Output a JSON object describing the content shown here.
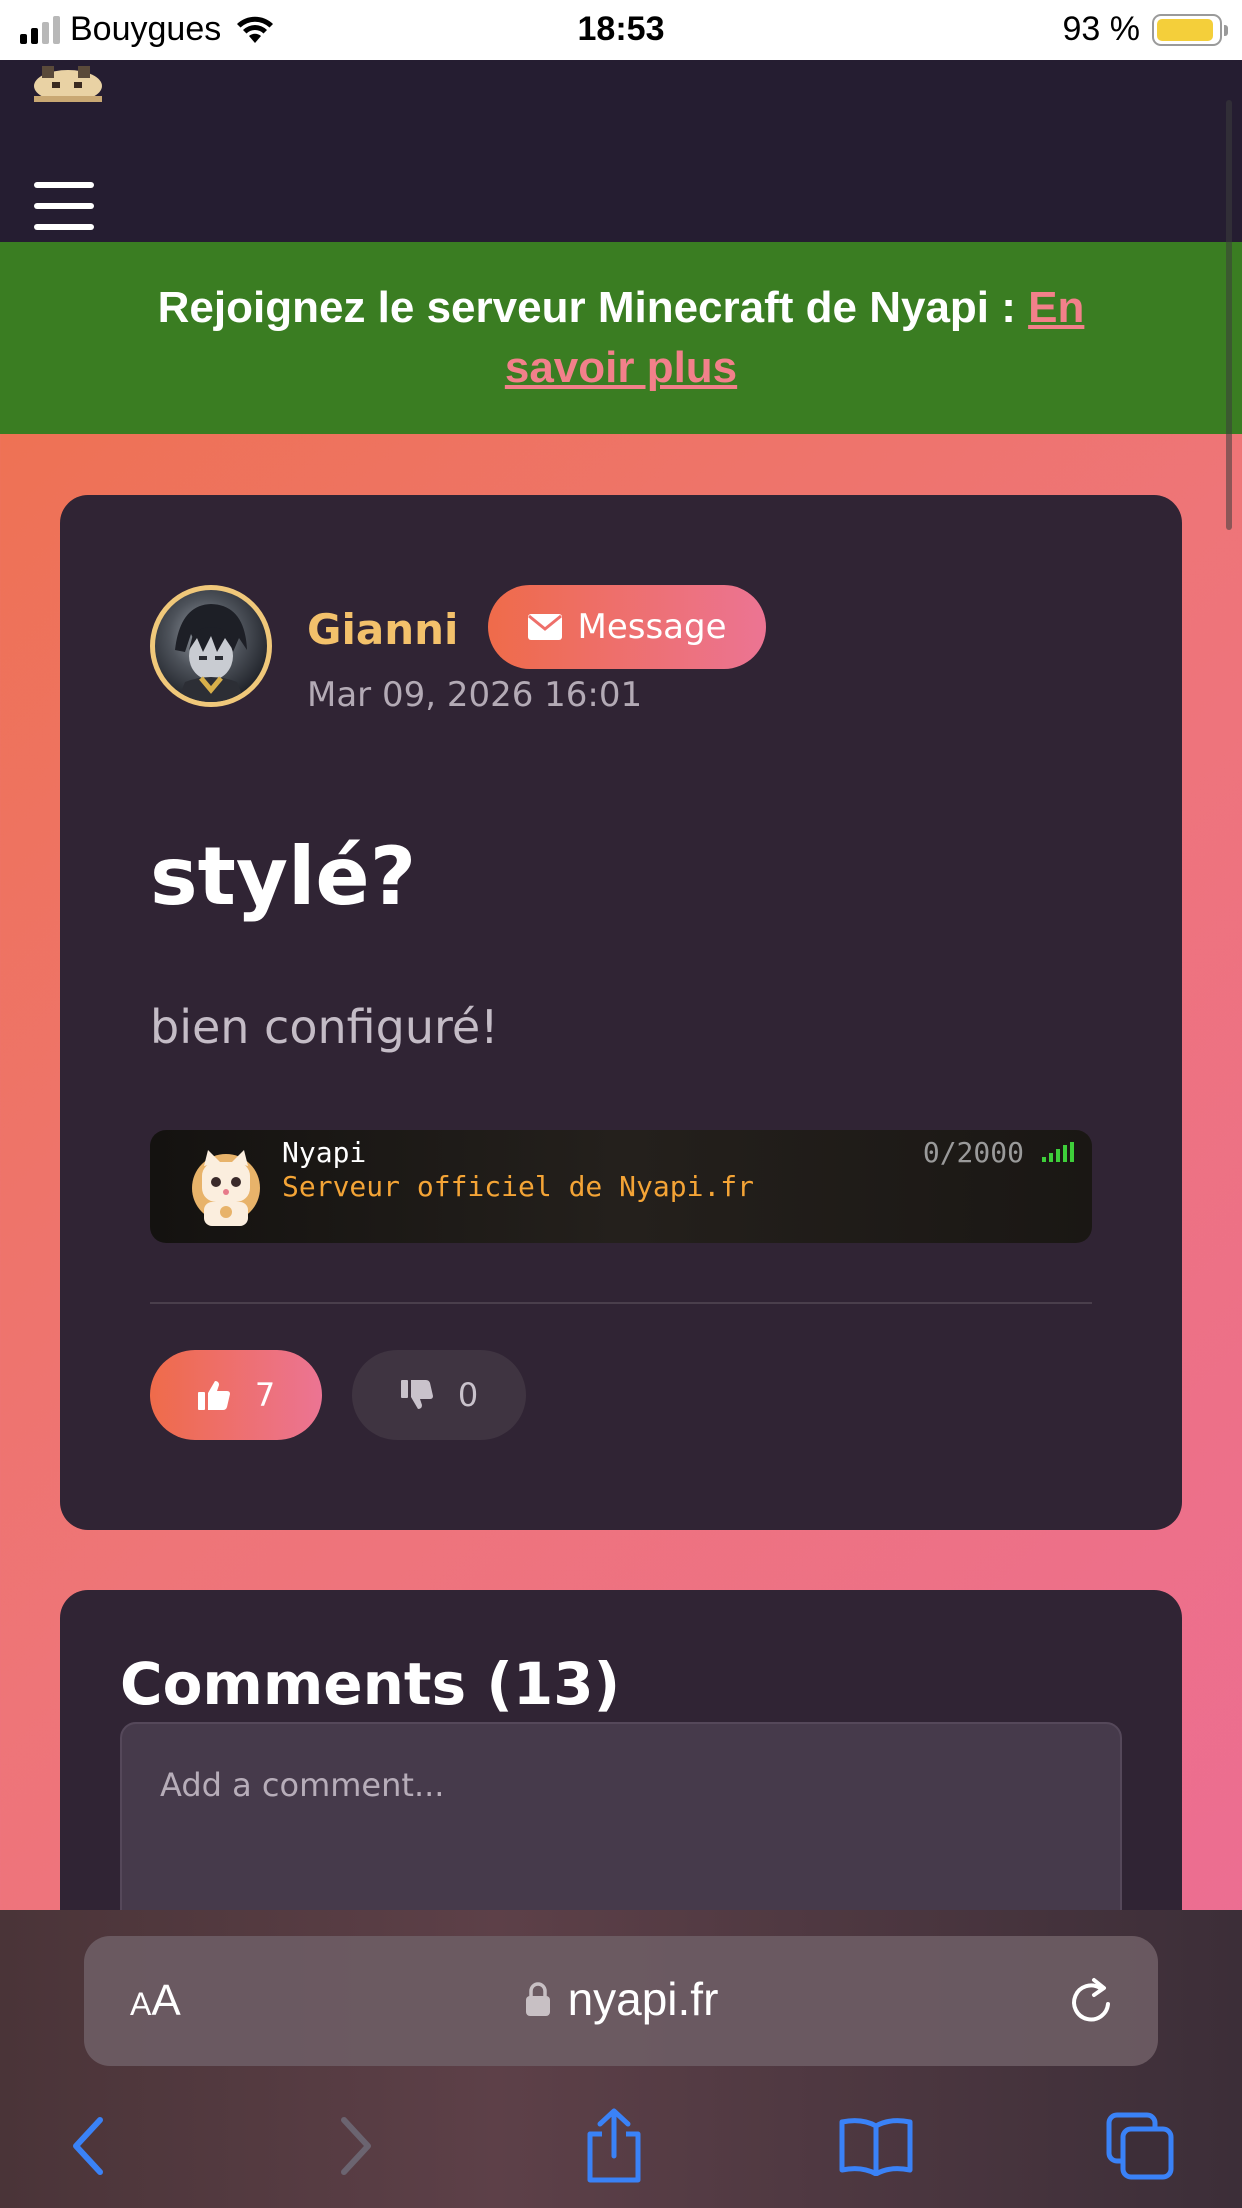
{
  "status_bar": {
    "carrier": "Bouygues",
    "time": "18:53",
    "battery_percent": "93 %",
    "battery_level": 0.93
  },
  "site": {
    "banner": {
      "text": "Rejoignez le serveur Minecraft de Nyapi : ",
      "link_text": "En savoir plus"
    }
  },
  "post": {
    "author": "Gianni",
    "message_button": "Message",
    "date": "Mar 09, 2026 16:01",
    "title": "stylé?",
    "body": "bien configuré!",
    "server_widget": {
      "name": "Nyapi",
      "motd": "Serveur officiel de Nyapi.fr",
      "players": "0/2000"
    },
    "likes": "7",
    "dislikes": "0"
  },
  "comments": {
    "title": "Comments (13)",
    "input_placeholder": "Add a comment..."
  },
  "browser": {
    "url": "nyapi.fr",
    "text_size_small": "A",
    "text_size_big": "A"
  },
  "colors": {
    "accent_gradient_start": "#ef6b4a",
    "accent_gradient_end": "#ec7493",
    "banner_green": "#3a7d22",
    "card_bg": "#302434",
    "author_gold": "#f3c16b",
    "ios_blue": "#3a82f7"
  }
}
